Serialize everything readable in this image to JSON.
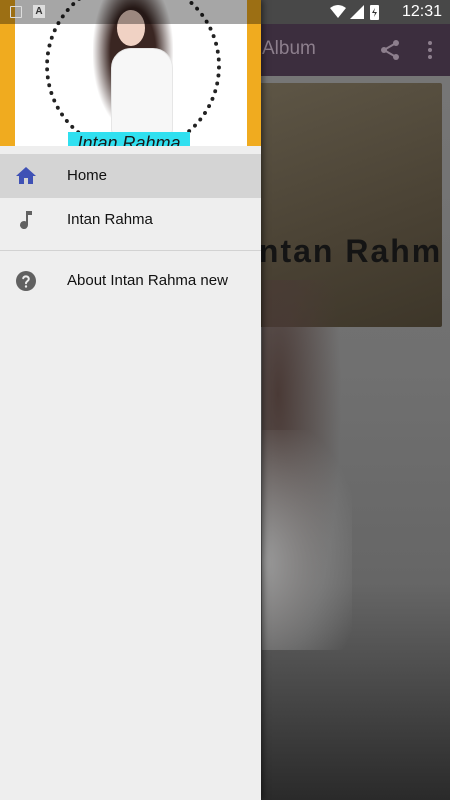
{
  "status_bar": {
    "time": "12:31",
    "notification_letter": "A"
  },
  "app": {
    "title": "Album",
    "banner_text": "Intan Rahma"
  },
  "drawer": {
    "header_name": "Intan Rahma",
    "items": [
      {
        "label": "Home",
        "icon": "home-icon",
        "active": true
      },
      {
        "label": "Intan Rahma",
        "icon": "music-note-icon",
        "active": false
      }
    ],
    "secondary_items": [
      {
        "label": "About Intan Rahma new",
        "icon": "help-icon"
      }
    ]
  },
  "colors": {
    "accent_blue": "#3f51b5",
    "header_bg": "#f0ab1f",
    "toolbar": "#3c2e3e"
  }
}
